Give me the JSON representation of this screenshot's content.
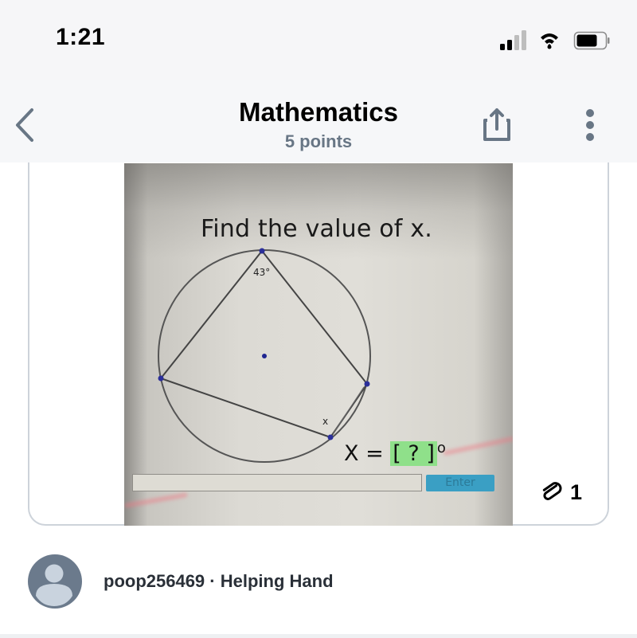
{
  "status_bar": {
    "time": "1:21",
    "signal_icon": "cellular-signal-icon",
    "signal_bars_active": 2,
    "signal_bars_total": 4,
    "wifi_icon": "wifi-icon",
    "battery_icon": "battery-icon",
    "battery_level": 0.6
  },
  "nav": {
    "back_icon": "chevron-left-icon",
    "title": "Mathematics",
    "subtitle": "5 points",
    "share_icon": "share-icon",
    "more_icon": "more-vertical-icon"
  },
  "question": {
    "image": {
      "title": "Find the value of x.",
      "angle_label": "43°",
      "unknown_label": "x",
      "equation_prefix": "X = ",
      "equation_box": "[ ? ]",
      "equation_suffix": "o",
      "input_value": "",
      "enter_label": "Enter"
    },
    "attachment_icon": "paperclip-icon",
    "attachment_count": "1"
  },
  "author": {
    "avatar_icon": "user-avatar-icon",
    "username": "poop256469",
    "separator": " · ",
    "rank": "Helping Hand"
  },
  "colors": {
    "header_bg": "#f6f7f9",
    "icon_gray": "#687685",
    "answer_box_green": "#8fe08a",
    "enter_blue": "#3a9fc4",
    "avatar_gray": "#6b7a8c"
  }
}
